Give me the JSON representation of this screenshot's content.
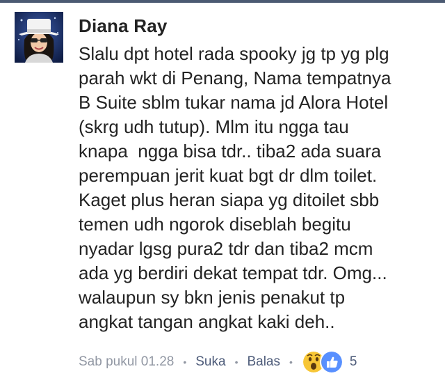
{
  "comment": {
    "author": "Diana Ray",
    "lines": [
      "Slalu dpt hotel rada spooky jg tp yg plg",
      "parah wkt di Penang, Nama tempatnya",
      "B Suite sblm tukar nama jd Alora Hotel",
      "(skrg udh tutup). Mlm itu ngga tau",
      "knapa  ngga bisa tdr.. tiba2 ada suara",
      "perempuan jerit kuat bgt dr dlm toilet.",
      "Kaget plus heran siapa yg ditoilet sbb",
      "temen udh ngorok diseblah begitu",
      "nyadar lgsg pura2 tdr dan tiba2 mcm",
      "ada yg berdiri dekat tempat tdr. Omg...",
      "walaupun sy bkn jenis penakut tp",
      "angkat tangan angkat kaki deh.."
    ],
    "timestamp": "Sab pukul 01.28",
    "like_label": "Suka",
    "reply_label": "Balas",
    "separator": "•",
    "reaction_count": "5",
    "reaction_icons": [
      "wow-reaction-icon",
      "like-reaction-icon"
    ]
  },
  "colors": {
    "topbar": "#4b5a72",
    "text": "#232323",
    "meta": "#9197a3",
    "link": "#4e5c7a",
    "like_blue": "#5890ff",
    "wow_yellow": "#f7c636"
  }
}
